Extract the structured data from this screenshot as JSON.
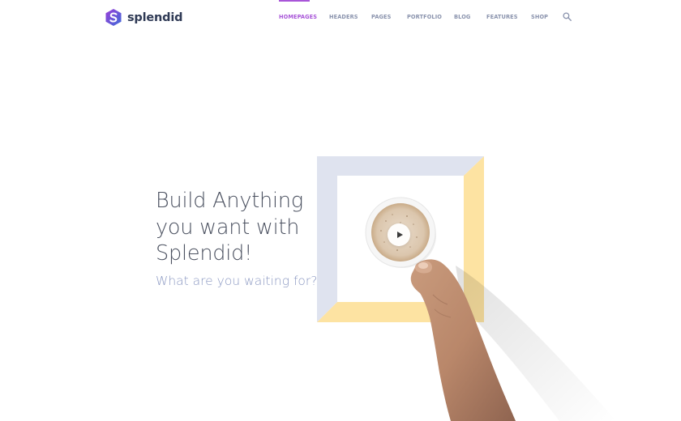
{
  "brand": {
    "name": "splendid"
  },
  "nav": {
    "items": [
      {
        "label": "HOMEPAGES",
        "active": true
      },
      {
        "label": "HEADERS",
        "active": false
      },
      {
        "label": "PAGES",
        "active": false
      },
      {
        "label": "PORTFOLIO",
        "active": false
      },
      {
        "label": "BLOG",
        "active": false
      },
      {
        "label": "FEATURES",
        "active": false
      },
      {
        "label": "SHOP",
        "active": false
      }
    ],
    "search_icon": "search-icon",
    "active_color": "#a855d8",
    "inactive_color": "#8a93ad"
  },
  "hero": {
    "title_lines": [
      "Build Anything",
      "you want with",
      "Splendid!"
    ],
    "subtitle": "What are you waiting for?",
    "media": {
      "play_icon": "play-icon"
    }
  },
  "colors": {
    "title": "#4b5160",
    "subtitle": "#8b98c2",
    "frame_blue": "#dfe3ef",
    "frame_yellow": "#fde3a2",
    "logo_purple": "#7b3fd0",
    "logo_blue": "#3f6bd8"
  }
}
